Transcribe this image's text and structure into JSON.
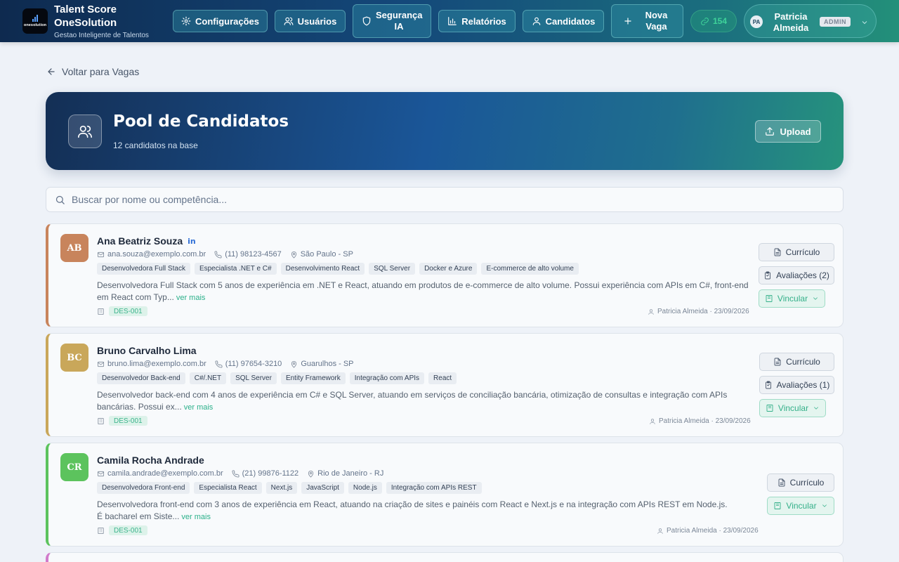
{
  "header": {
    "brand_title": "Talent Score OneSolution",
    "brand_subtitle": "Gestao Inteligente de Talentos",
    "logo_text": "onesolution",
    "nav": {
      "config": "Configurações",
      "users": "Usuários",
      "security": "Segurança IA",
      "reports": "Relatórios",
      "candidates": "Candidatos",
      "new_job": "Nova Vaga"
    },
    "counter": "154",
    "user": {
      "initials": "PA",
      "name": "Patricia Almeida",
      "role": "ADMIN"
    }
  },
  "back_label": "Voltar para Vagas",
  "hero": {
    "title": "Pool de Candidatos",
    "subtitle": "12 candidatos na base",
    "upload_label": "Upload"
  },
  "search": {
    "placeholder": "Buscar por nome ou competência..."
  },
  "labels": {
    "resume": "Currículo",
    "link": "Vincular",
    "see_more": "ver mais"
  },
  "colors": {
    "accent_green": "#2bb08a",
    "card1": "#c8845c",
    "card2": "#c9a75a",
    "card3": "#5cc35d",
    "card4": "#d17bcb"
  },
  "candidates": [
    {
      "initials": "AB",
      "name": "Ana Beatriz Souza",
      "linkedin": "in",
      "email": "ana.souza@exemplo.com.br",
      "phone": "(11) 98123-4567",
      "location": "São Paulo - SP",
      "tags": [
        "Desenvolvedora Full Stack",
        "Especialista .NET e C#",
        "Desenvolvimento React",
        "SQL Server",
        "Docker e Azure",
        "E-commerce de alto volume"
      ],
      "desc": "Desenvolvedora Full Stack com 5 anos de experiência em .NET e React, atuando em produtos de e-commerce de alto volume. Possui experiência com APIs em C#, front-end em React com Typ...",
      "code": "DES-001",
      "owner": "Patricia Almeida · 23/09/2026",
      "evaluations": "Avaliações (2)"
    },
    {
      "initials": "BC",
      "name": "Bruno Carvalho Lima",
      "email": "bruno.lima@exemplo.com.br",
      "phone": "(11) 97654-3210",
      "location": "Guarulhos - SP",
      "tags": [
        "Desenvolvedor Back-end",
        "C#/.NET",
        "SQL Server",
        "Entity Framework",
        "Integração com APIs",
        "React"
      ],
      "desc": "Desenvolvedor back-end com 4 anos de experiência em C# e SQL Server, atuando em serviços de conciliação bancária, otimização de consultas e integração com APIs bancárias. Possui ex...",
      "code": "DES-001",
      "owner": "Patricia Almeida · 23/09/2026",
      "evaluations": "Avaliações (1)"
    },
    {
      "initials": "CR",
      "name": "Camila Rocha Andrade",
      "email": "camila.andrade@exemplo.com.br",
      "phone": "(21) 99876-1122",
      "location": "Rio de Janeiro - RJ",
      "tags": [
        "Desenvolvedora Front-end",
        "Especialista React",
        "Next.js",
        "JavaScript",
        "Node.js",
        "Integração com APIs REST"
      ],
      "desc": "Desenvolvedora front-end com 3 anos de experiência em React, atuando na criação de sites e painéis com React e Next.js e na integração com APIs REST em Node.js. É bacharel em Siste...",
      "code": "DES-001",
      "owner": "Patricia Almeida · 23/09/2026"
    }
  ]
}
